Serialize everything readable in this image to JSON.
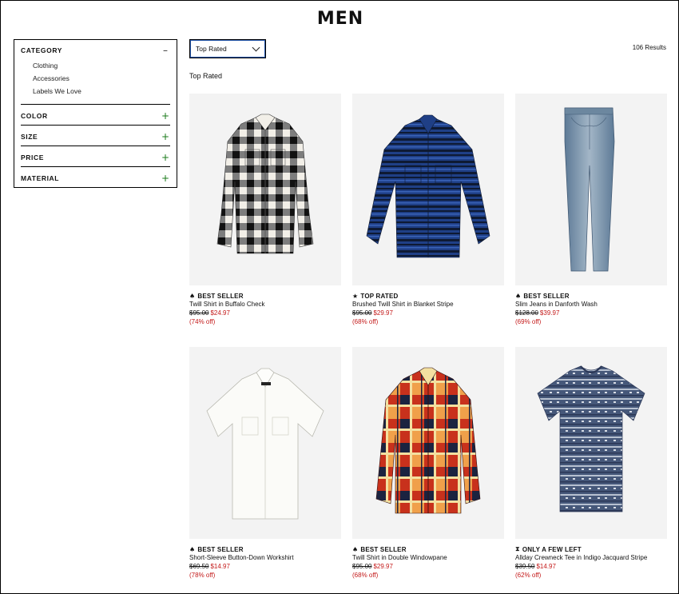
{
  "page": {
    "title": "MEN"
  },
  "filters": [
    {
      "title": "CATEGORY",
      "toggle": "–",
      "open": true,
      "items": [
        "Clothing",
        "Accessories",
        "Labels We Love"
      ]
    },
    {
      "title": "COLOR",
      "toggle": "+"
    },
    {
      "title": "SIZE",
      "toggle": "+"
    },
    {
      "title": "PRICE",
      "toggle": "+"
    },
    {
      "title": "MATERIAL",
      "toggle": "+"
    }
  ],
  "toolbar": {
    "sort_value": "Top Rated",
    "results": "106 Results",
    "sort_heading": "Top Rated"
  },
  "colors": {
    "sale": "#c41a1a",
    "plus": "#1a7a1a",
    "tile_bg": "#f3f3f3"
  },
  "products": [
    {
      "badge": "BEST SELLER",
      "badge_icon": "flame-icon",
      "badge_glyph": "♠",
      "name": "Twill Shirt in Buffalo Check",
      "orig_price": "$95.00",
      "sale_price": "$24.97",
      "discount": "(74% off)"
    },
    {
      "badge": "TOP RATED",
      "badge_icon": "star-icon",
      "badge_glyph": "★",
      "name": "Brushed Twill Shirt in Blanket Stripe",
      "orig_price": "$95.00",
      "sale_price": "$29.97",
      "discount": "(68% off)"
    },
    {
      "badge": "BEST SELLER",
      "badge_icon": "flame-icon",
      "badge_glyph": "♠",
      "name": "Slim Jeans in Danforth Wash",
      "orig_price": "$128.00",
      "sale_price": "$39.97",
      "discount": "(69% off)"
    },
    {
      "badge": "BEST SELLER",
      "badge_icon": "flame-icon",
      "badge_glyph": "♠",
      "name": "Short-Sleeve Button-Down Workshirt",
      "orig_price": "$69.50",
      "sale_price": "$14.97",
      "discount": "(78% off)"
    },
    {
      "badge": "BEST SELLER",
      "badge_icon": "flame-icon",
      "badge_glyph": "♠",
      "name": "Twill Shirt in Double Windowpane",
      "orig_price": "$95.00",
      "sale_price": "$29.97",
      "discount": "(68% off)"
    },
    {
      "badge": "ONLY A FEW LEFT",
      "badge_icon": "hourglass-icon",
      "badge_glyph": "⧗",
      "name": "Allday Crewneck Tee in Indigo Jacquard Stripe",
      "orig_price": "$39.50",
      "sale_price": "$14.97",
      "discount": "(62% off)"
    }
  ]
}
